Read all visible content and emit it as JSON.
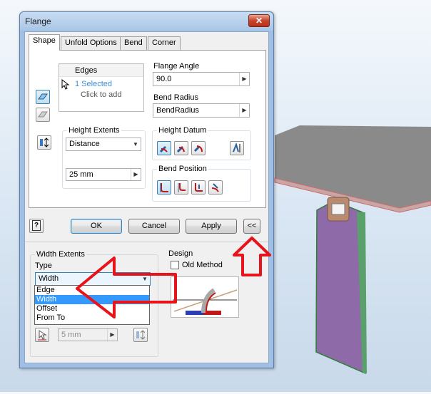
{
  "window": {
    "title": "Flange",
    "close_glyph": "✕"
  },
  "tabs": [
    {
      "label": "Shape",
      "active": true
    },
    {
      "label": "Unfold Options",
      "active": false
    },
    {
      "label": "Bend",
      "active": false
    },
    {
      "label": "Corner",
      "active": false
    }
  ],
  "shape": {
    "edges_header": "Edges",
    "edges_selected": "1 Selected",
    "edges_click": "Click to add",
    "flange_angle_label": "Flange Angle",
    "flange_angle_value": "90.0",
    "bend_radius_label": "Bend Radius",
    "bend_radius_value": "BendRadius",
    "height_extents_label": "Height Extents",
    "height_extents_value": "Distance",
    "height_value": "25 mm",
    "height_datum_label": "Height Datum",
    "bend_position_label": "Bend Position"
  },
  "buttons": {
    "help": "?",
    "ok": "OK",
    "cancel": "Cancel",
    "apply": "Apply",
    "collapse": "<<"
  },
  "width_extents": {
    "group_label": "Width Extents",
    "type_label": "Type",
    "selected": "Width",
    "options": [
      "Edge",
      "Width",
      "Offset",
      "From To"
    ],
    "offset_value": "5 mm"
  },
  "design": {
    "group_label": "Design",
    "old_method_label": "Old Method",
    "old_method_checked": false
  },
  "colors": {
    "annotation_arrow": "#e8141b",
    "selection_blue": "#3399ff",
    "flange_face": "#8e6aa8",
    "sheet_top": "#8f8f8f"
  }
}
